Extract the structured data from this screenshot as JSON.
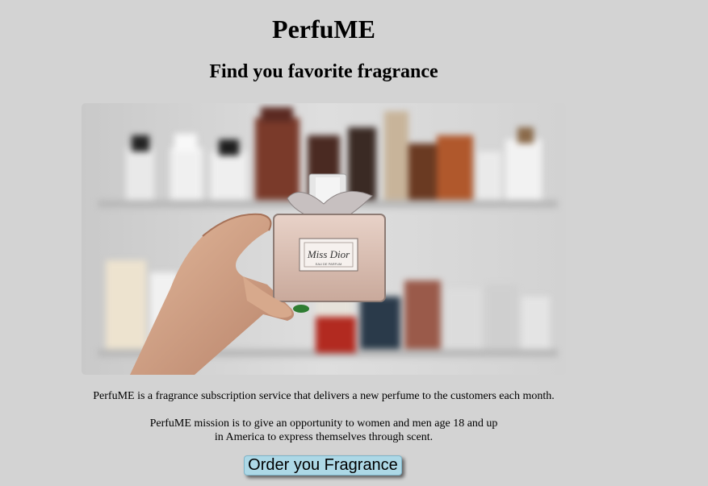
{
  "header": {
    "title": "PerfuME",
    "subtitle": "Find you favorite fragrance"
  },
  "hero": {
    "image_name": "perfume-bottle-photo",
    "bottle_label": "Miss Dior",
    "bottle_sublabel": "EAU DE PARFUM"
  },
  "content": {
    "description": "PerfuME is a fragrance subscription service that delivers a new perfume to the customers each month.",
    "mission_line1": "PerfuME mission is to give an opportunity to women and men age 18 and up",
    "mission_line2": "in America to express themselves through scent."
  },
  "cta": {
    "order_label": "Order you Fragrance"
  },
  "colors": {
    "background": "#d3d3d3",
    "button": "#add8e6"
  }
}
